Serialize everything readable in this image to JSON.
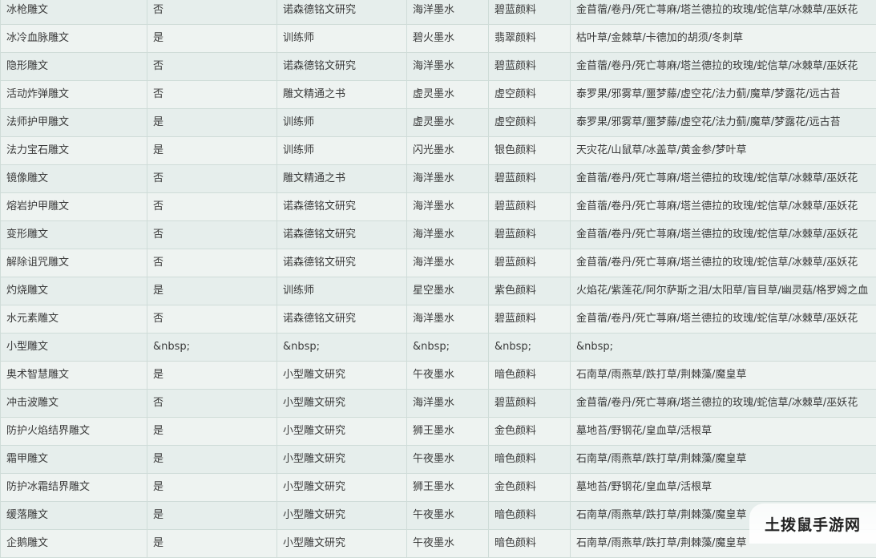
{
  "table": {
    "rows": [
      [
        "冰枪雕文",
        "否",
        "诺森德铭文研究",
        "海洋墨水",
        "碧蓝颜料",
        "金苜蓿/卷丹/死亡荨麻/塔兰德拉的玫瑰/蛇信草/冰棘草/巫妖花"
      ],
      [
        "冰冷血脉雕文",
        "是",
        "训练师",
        "碧火墨水",
        "翡翠颜料",
        "枯叶草/金棘草/卡德加的胡须/冬刺草"
      ],
      [
        "隐形雕文",
        "否",
        "诺森德铭文研究",
        "海洋墨水",
        "碧蓝颜料",
        "金苜蓿/卷丹/死亡荨麻/塔兰德拉的玫瑰/蛇信草/冰棘草/巫妖花"
      ],
      [
        "活动炸弹雕文",
        "否",
        "雕文精通之书",
        "虚灵墨水",
        "虚空颜料",
        "泰罗果/邪雾草/噩梦藤/虚空花/法力蓟/魔草/梦露花/远古苔"
      ],
      [
        "法师护甲雕文",
        "是",
        "训练师",
        "虚灵墨水",
        "虚空颜料",
        "泰罗果/邪雾草/噩梦藤/虚空花/法力蓟/魔草/梦露花/远古苔"
      ],
      [
        "法力宝石雕文",
        "是",
        "训练师",
        "闪光墨水",
        "银色颜料",
        "天灾花/山鼠草/冰盖草/黄金参/梦叶草"
      ],
      [
        "镜像雕文",
        "否",
        "雕文精通之书",
        "海洋墨水",
        "碧蓝颜料",
        "金苜蓿/卷丹/死亡荨麻/塔兰德拉的玫瑰/蛇信草/冰棘草/巫妖花"
      ],
      [
        "熔岩护甲雕文",
        "否",
        "诺森德铭文研究",
        "海洋墨水",
        "碧蓝颜料",
        "金苜蓿/卷丹/死亡荨麻/塔兰德拉的玫瑰/蛇信草/冰棘草/巫妖花"
      ],
      [
        "变形雕文",
        "否",
        "诺森德铭文研究",
        "海洋墨水",
        "碧蓝颜料",
        "金苜蓿/卷丹/死亡荨麻/塔兰德拉的玫瑰/蛇信草/冰棘草/巫妖花"
      ],
      [
        "解除诅咒雕文",
        "否",
        "诺森德铭文研究",
        "海洋墨水",
        "碧蓝颜料",
        "金苜蓿/卷丹/死亡荨麻/塔兰德拉的玫瑰/蛇信草/冰棘草/巫妖花"
      ],
      [
        "灼烧雕文",
        "是",
        "训练师",
        "星空墨水",
        "紫色颜料",
        "火焰花/紫莲花/阿尔萨斯之泪/太阳草/盲目草/幽灵菇/格罗姆之血"
      ],
      [
        "水元素雕文",
        "否",
        "诺森德铭文研究",
        "海洋墨水",
        "碧蓝颜料",
        "金苜蓿/卷丹/死亡荨麻/塔兰德拉的玫瑰/蛇信草/冰棘草/巫妖花"
      ],
      [
        "小型雕文",
        "&nbsp;",
        "&nbsp;",
        "&nbsp;",
        "&nbsp;",
        "&nbsp;"
      ],
      [
        "奥术智慧雕文",
        "是",
        "小型雕文研究",
        "午夜墨水",
        "暗色颜料",
        "石南草/雨燕草/跌打草/荆棘藻/魔皇草"
      ],
      [
        "冲击波雕文",
        "否",
        "小型雕文研究",
        "海洋墨水",
        "碧蓝颜料",
        "金苜蓿/卷丹/死亡荨麻/塔兰德拉的玫瑰/蛇信草/冰棘草/巫妖花"
      ],
      [
        "防护火焰结界雕文",
        "是",
        "小型雕文研究",
        "狮王墨水",
        "金色颜料",
        "墓地苔/野钢花/皇血草/活根草"
      ],
      [
        "霜甲雕文",
        "是",
        "小型雕文研究",
        "午夜墨水",
        "暗色颜料",
        "石南草/雨燕草/跌打草/荆棘藻/魔皇草"
      ],
      [
        "防护冰霜结界雕文",
        "是",
        "小型雕文研究",
        "狮王墨水",
        "金色颜料",
        "墓地苔/野钢花/皇血草/活根草"
      ],
      [
        "缓落雕文",
        "是",
        "小型雕文研究",
        "午夜墨水",
        "暗色颜料",
        "石南草/雨燕草/跌打草/荆棘藻/魔皇草"
      ],
      [
        "企鹅雕文",
        "是",
        "小型雕文研究",
        "午夜墨水",
        "暗色颜料",
        "石南草/雨燕草/跌打草/荆棘藻/魔皇草"
      ]
    ]
  },
  "watermark": {
    "text": "土拨鼠手游网"
  }
}
